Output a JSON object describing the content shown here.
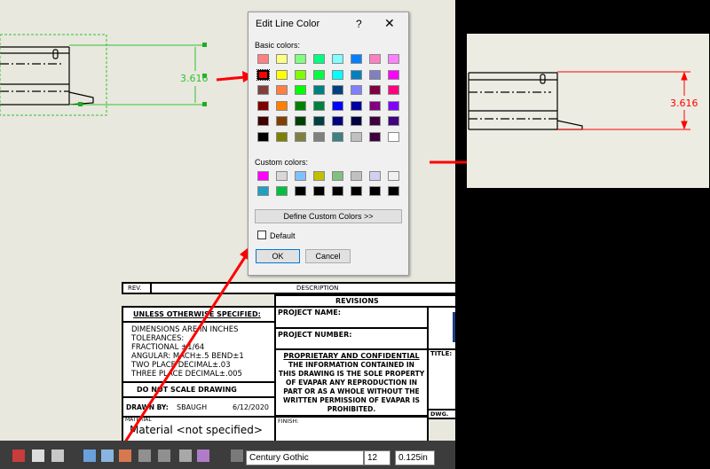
{
  "dialog": {
    "title": "Edit Line Color",
    "help_glyph": "?",
    "close_glyph": "✕",
    "basic_label": "Basic colors:",
    "custom_label": "Custom colors:",
    "define_button": "Define Custom Colors >>",
    "default_label": "Default",
    "ok_button": "OK",
    "cancel_button": "Cancel",
    "basic_colors": [
      [
        "#ff8080",
        "#ffff80",
        "#80ff80",
        "#00ff80",
        "#80ffff",
        "#0080ff",
        "#ff80c0",
        "#ff80ff"
      ],
      [
        "#ff0000",
        "#ffff00",
        "#80ff00",
        "#00ff40",
        "#00ffff",
        "#0080c0",
        "#8080c0",
        "#ff00ff"
      ],
      [
        "#804040",
        "#ff8040",
        "#00ff00",
        "#008080",
        "#004080",
        "#8080ff",
        "#800040",
        "#ff0080"
      ],
      [
        "#800000",
        "#ff8000",
        "#008000",
        "#008040",
        "#0000ff",
        "#0000a0",
        "#800080",
        "#8000ff"
      ],
      [
        "#400000",
        "#804000",
        "#004000",
        "#004040",
        "#000080",
        "#000040",
        "#400040",
        "#400080"
      ],
      [
        "#000000",
        "#808000",
        "#808040",
        "#808080",
        "#408080",
        "#c0c0c0",
        "#400040",
        "#ffffff"
      ]
    ],
    "custom_colors": [
      [
        "#ff00ff",
        "#d8d8d8",
        "#80c0ff",
        "#c0c000",
        "#80c080",
        "#c0c0c0",
        "#d0d0f0",
        "#f0f0f0"
      ],
      [
        "#20a0c0",
        "#00c040",
        "#000000",
        "#000000",
        "#000000",
        "#000000",
        "#000000",
        "#000000"
      ]
    ]
  },
  "dimension": {
    "left_value": "3.616",
    "right_value": "3.616"
  },
  "title_block": {
    "rev": "REV.",
    "description": "DESCRIPTION",
    "revisions": "REVISIONS",
    "unless_specified": "UNLESS OTHERWISE SPECIFIED:",
    "project_name": "PROJECT NAME:",
    "project_number": "PROJECT NUMBER:",
    "tolerances": [
      "DIMENSIONS ARE IN INCHES",
      "TOLERANCES:",
      "FRACTIONAL ±1/64",
      "ANGULAR: MACH±.5  BEND±1",
      "TWO PLACE DECIMAL±.03",
      "THREE PLACE DECIMAL±.005"
    ],
    "proprietary_title": "PROPRIETARY AND CONFIDENTIAL",
    "proprietary_text": [
      "THE INFORMATION CONTAINED IN",
      "THIS DRAWING IS THE SOLE PROPERTY",
      "OF EVAPAR ANY REPRODUCTION IN",
      "PART OR AS A WHOLE WITHOUT THE",
      "WRITTEN PERMISSION OF EVAPAR IS",
      "PROHIBITED."
    ],
    "title_label": "TITLE:",
    "do_not_scale": "DO NOT SCALE DRAWING",
    "drawn_by": "DRAWN BY:",
    "drawn_by_name": "SBAUGH",
    "drawn_date": "6/12/2020",
    "dwg_label": "DWG.",
    "material_label": "MATERIAL",
    "material_value": "Material <not specified>",
    "finish_label": "FINISH:"
  },
  "toolbar": {
    "font_name": "Century Gothic",
    "font_size": "12",
    "line_height": "0.125in"
  },
  "colors": {
    "arrow": "#ff0000",
    "dim_green": "#00c000",
    "dim_red": "#ff0000",
    "selected_swatch": "#ff0000"
  }
}
